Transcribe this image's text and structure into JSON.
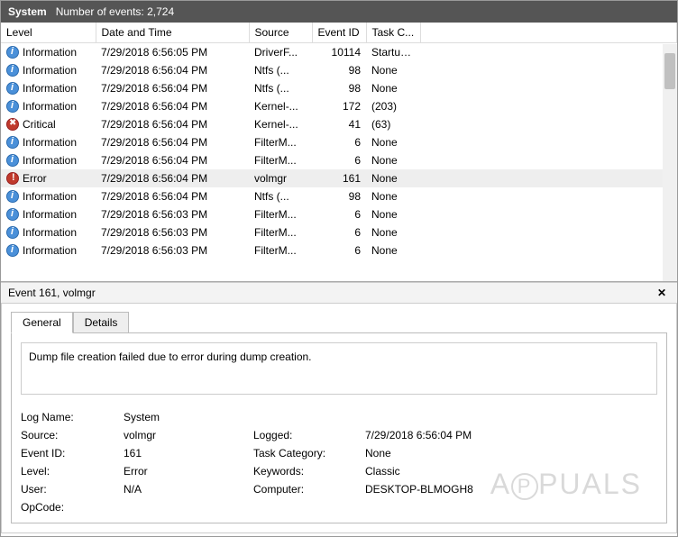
{
  "header": {
    "title": "System",
    "count_label": "Number of events: 2,724"
  },
  "columns": {
    "level": "Level",
    "date": "Date and Time",
    "source": "Source",
    "eventid": "Event ID",
    "task": "Task C..."
  },
  "events": [
    {
      "icon": "info",
      "level": "Information",
      "date": "7/29/2018 6:56:05 PM",
      "source": "DriverF...",
      "eventid": "10114",
      "task": "Startup..."
    },
    {
      "icon": "info",
      "level": "Information",
      "date": "7/29/2018 6:56:04 PM",
      "source": "Ntfs (...",
      "eventid": "98",
      "task": "None"
    },
    {
      "icon": "info",
      "level": "Information",
      "date": "7/29/2018 6:56:04 PM",
      "source": "Ntfs (...",
      "eventid": "98",
      "task": "None"
    },
    {
      "icon": "info",
      "level": "Information",
      "date": "7/29/2018 6:56:04 PM",
      "source": "Kernel-...",
      "eventid": "172",
      "task": "(203)"
    },
    {
      "icon": "critical",
      "level": "Critical",
      "date": "7/29/2018 6:56:04 PM",
      "source": "Kernel-...",
      "eventid": "41",
      "task": "(63)"
    },
    {
      "icon": "info",
      "level": "Information",
      "date": "7/29/2018 6:56:04 PM",
      "source": "FilterM...",
      "eventid": "6",
      "task": "None"
    },
    {
      "icon": "info",
      "level": "Information",
      "date": "7/29/2018 6:56:04 PM",
      "source": "FilterM...",
      "eventid": "6",
      "task": "None"
    },
    {
      "icon": "error",
      "level": "Error",
      "date": "7/29/2018 6:56:04 PM",
      "source": "volmgr",
      "eventid": "161",
      "task": "None",
      "selected": true
    },
    {
      "icon": "info",
      "level": "Information",
      "date": "7/29/2018 6:56:04 PM",
      "source": "Ntfs (...",
      "eventid": "98",
      "task": "None"
    },
    {
      "icon": "info",
      "level": "Information",
      "date": "7/29/2018 6:56:03 PM",
      "source": "FilterM...",
      "eventid": "6",
      "task": "None"
    },
    {
      "icon": "info",
      "level": "Information",
      "date": "7/29/2018 6:56:03 PM",
      "source": "FilterM...",
      "eventid": "6",
      "task": "None"
    },
    {
      "icon": "info",
      "level": "Information",
      "date": "7/29/2018 6:56:03 PM",
      "source": "FilterM...",
      "eventid": "6",
      "task": "None"
    }
  ],
  "detail": {
    "title": "Event 161, volmgr",
    "tabs": {
      "general": "General",
      "details": "Details"
    },
    "message": "Dump file creation failed due to error during dump creation.",
    "labels": {
      "logname": "Log Name:",
      "source": "Source:",
      "eventid": "Event ID:",
      "level": "Level:",
      "user": "User:",
      "opcode": "OpCode:",
      "logged": "Logged:",
      "taskcat": "Task Category:",
      "keywords": "Keywords:",
      "computer": "Computer:"
    },
    "values": {
      "logname": "System",
      "source": "volmgr",
      "eventid": "161",
      "level": "Error",
      "user": "N/A",
      "opcode": "",
      "logged": "7/29/2018 6:56:04 PM",
      "taskcat": "None",
      "keywords": "Classic",
      "computer": "DESKTOP-BLMOGH8"
    }
  },
  "watermark": "A PUALS"
}
